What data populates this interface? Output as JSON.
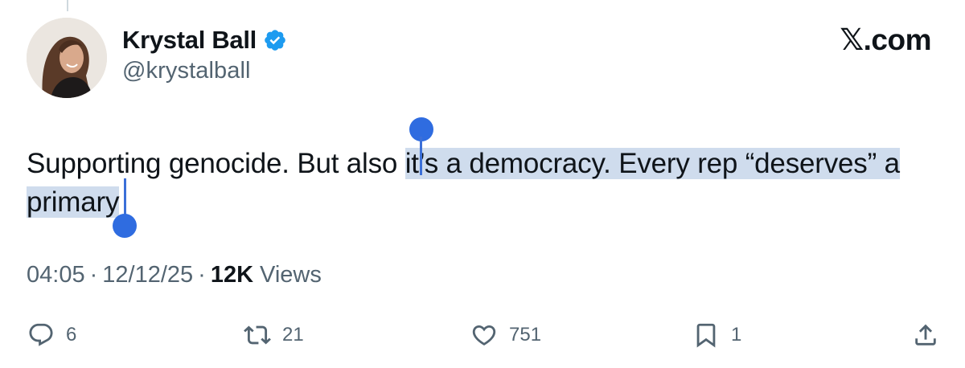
{
  "tweet": {
    "author": {
      "display_name": "Krystal Ball",
      "handle": "@krystalball",
      "verified": true
    },
    "brand": "𝕏.com",
    "text_before_selection": "Supporting genocide. But also ",
    "text_selected": "it’s a democracy. Every rep “deserves” a primary",
    "time": "04:05",
    "date": "12/12/25",
    "views_count": "12K",
    "views_label": "Views",
    "separator": "·"
  },
  "actions": {
    "replies": "6",
    "reposts": "21",
    "likes": "751",
    "bookmarks": "1"
  },
  "colors": {
    "text": "#0f1419",
    "secondary": "#536471",
    "verified": "#1d9bf0",
    "selection": "#cfdced",
    "selection_handle": "#2f6ce0"
  },
  "icons": [
    "verified-badge-icon",
    "reply-icon",
    "repost-icon",
    "like-icon",
    "bookmark-icon",
    "share-icon"
  ]
}
